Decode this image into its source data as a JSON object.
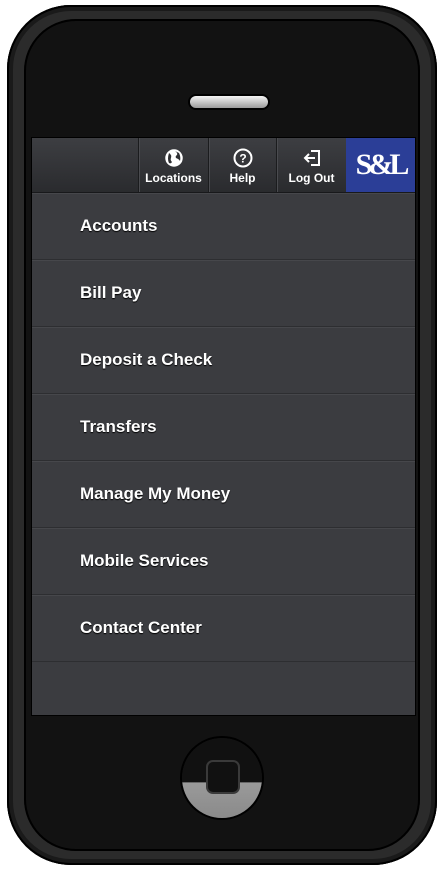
{
  "topbar": {
    "locations_label": "Locations",
    "help_label": "Help",
    "logout_label": "Log Out",
    "logo_text": "S&L",
    "logo_color": "#2b3e97"
  },
  "icons": {
    "locations": "globe-icon",
    "help": "question-circle-icon",
    "logout": "logout-arrow-icon"
  },
  "menu": {
    "items": [
      {
        "label": "Accounts"
      },
      {
        "label": "Bill Pay"
      },
      {
        "label": "Deposit a Check"
      },
      {
        "label": "Transfers"
      },
      {
        "label": "Manage My Money"
      },
      {
        "label": "Mobile Services"
      },
      {
        "label": "Contact Center"
      }
    ]
  }
}
